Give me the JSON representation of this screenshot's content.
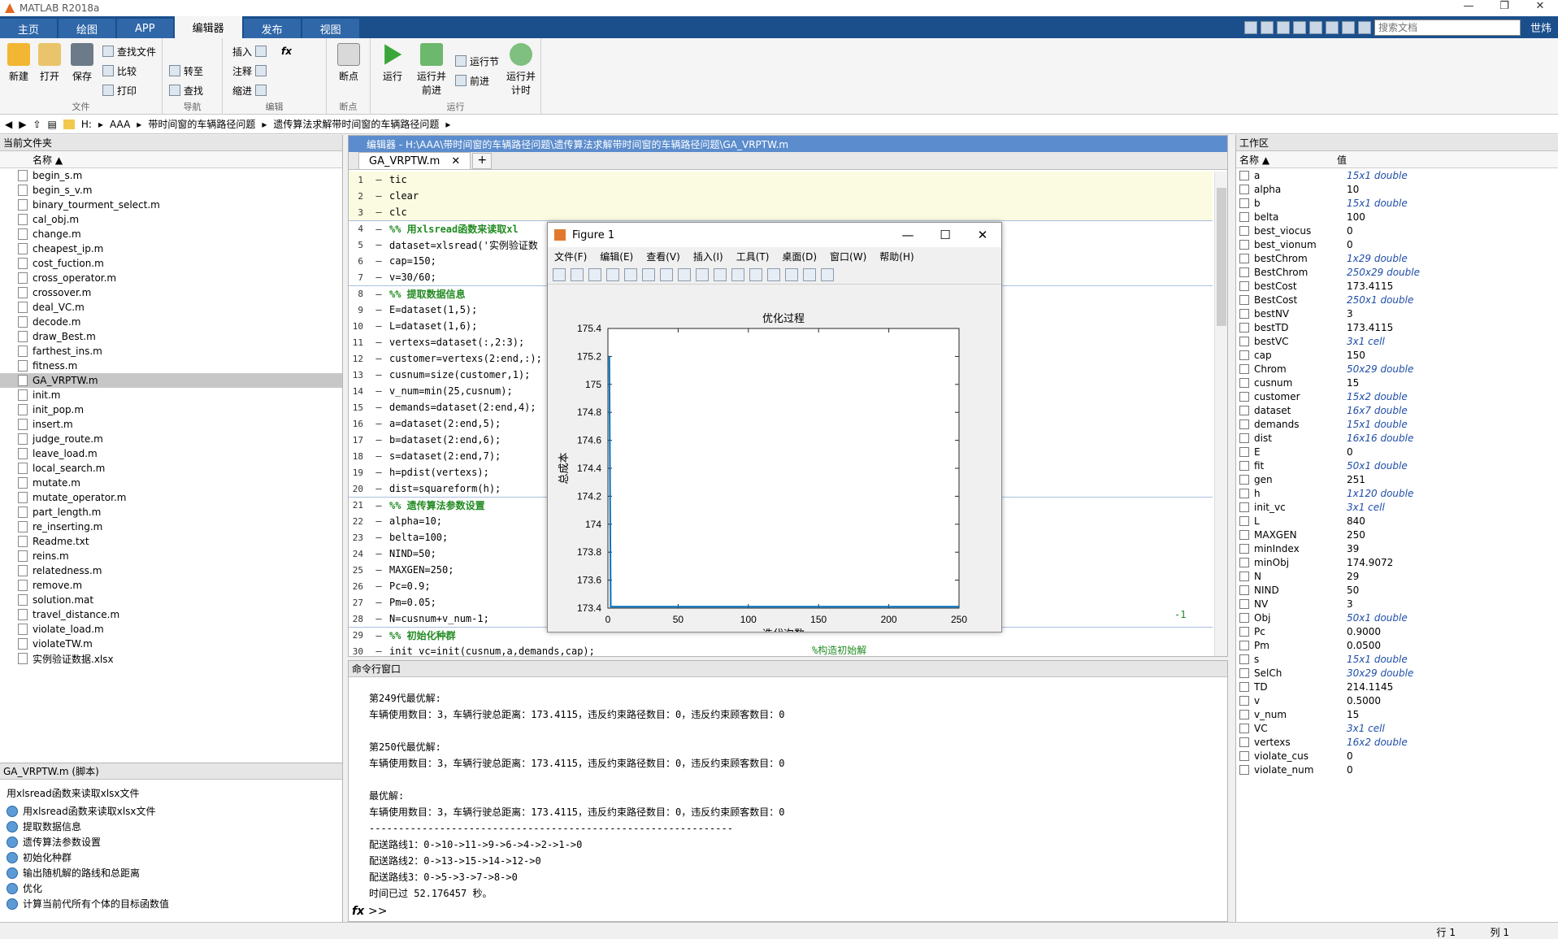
{
  "app": {
    "title": "MATLAB R2018a"
  },
  "ribbon": {
    "tabs": [
      "主页",
      "绘图",
      "APP",
      "编辑器",
      "发布",
      "视图"
    ],
    "search_placeholder": "搜索文档",
    "user": "世炜",
    "file_group": {
      "label": "文件",
      "new": "新建",
      "open": "打开",
      "save": "保存",
      "find_files": "查找文件",
      "compare": "比较",
      "print": "打印"
    },
    "nav_group": {
      "label": "导航",
      "goto": "转至",
      "find": "查找"
    },
    "edit_group": {
      "label": "编辑",
      "insert": "插入",
      "comment": "注释",
      "indent": "缩进",
      "fx": "fx"
    },
    "breakpoint_group": {
      "label": "断点",
      "breakpoints": "断点"
    },
    "run_group": {
      "label": "运行",
      "run": "运行",
      "run_advance": "运行并\n前进",
      "run_section": "运行节",
      "advance": "前进",
      "run_time": "运行并\n计时"
    }
  },
  "addressbar": {
    "path": [
      "H:",
      "AAA",
      "带时间窗的车辆路径问题",
      "遗传算法求解带时间窗的车辆路径问题"
    ]
  },
  "current_folder": {
    "title": "当前文件夹",
    "col_name": "名称 ▲",
    "files": [
      "begin_s.m",
      "begin_s_v.m",
      "binary_tourment_select.m",
      "cal_obj.m",
      "change.m",
      "cheapest_ip.m",
      "cost_fuction.m",
      "cross_operator.m",
      "crossover.m",
      "deal_VC.m",
      "decode.m",
      "draw_Best.m",
      "farthest_ins.m",
      "fitness.m",
      "GA_VRPTW.m",
      "init.m",
      "init_pop.m",
      "insert.m",
      "judge_route.m",
      "leave_load.m",
      "local_search.m",
      "mutate.m",
      "mutate_operator.m",
      "part_length.m",
      "re_inserting.m",
      "Readme.txt",
      "reins.m",
      "relatedness.m",
      "remove.m",
      "solution.mat",
      "travel_distance.m",
      "violate_load.m",
      "violateTW.m",
      "实例验证数据.xlsx"
    ],
    "selected": "GA_VRPTW.m"
  },
  "details": {
    "title": "GA_VRPTW.m (脚本)",
    "desc": "用xlsread函数来读取xlsx文件",
    "sections": [
      "用xlsread函数来读取xlsx文件",
      "提取数据信息",
      "遗传算法参数设置",
      "初始化种群",
      "输出随机解的路线和总距离",
      "优化",
      "计算当前代所有个体的目标函数值"
    ]
  },
  "editor": {
    "header": "编辑器 - H:\\AAA\\带时间窗的车辆路径问题\\遗传算法求解带时间窗的车辆路径问题\\GA_VRPTW.m",
    "tab": "GA_VRPTW.m",
    "lines": [
      {
        "n": "1",
        "t": "tic",
        "c": ""
      },
      {
        "n": "2",
        "t": "clear",
        "c": ""
      },
      {
        "n": "3",
        "t": "clc",
        "c": ""
      },
      {
        "n": "4",
        "t": "%% 用xlsread函数来读取xl",
        "c": "cmt"
      },
      {
        "n": "5",
        "t": "dataset=xlsread('实例验证数",
        "c": ""
      },
      {
        "n": "6",
        "t": "cap=150;",
        "c": ""
      },
      {
        "n": "7",
        "t": "v=30/60;",
        "c": ""
      },
      {
        "n": "8",
        "t": "%% 提取数据信息",
        "c": "cmt"
      },
      {
        "n": "9",
        "t": "E=dataset(1,5);",
        "c": ""
      },
      {
        "n": "10",
        "t": "L=dataset(1,6);",
        "c": ""
      },
      {
        "n": "11",
        "t": "vertexs=dataset(:,2:3);",
        "c": ""
      },
      {
        "n": "12",
        "t": "customer=vertexs(2:end,:);",
        "c": ""
      },
      {
        "n": "13",
        "t": "cusnum=size(customer,1);",
        "c": ""
      },
      {
        "n": "14",
        "t": "v_num=min(25,cusnum);",
        "c": ""
      },
      {
        "n": "15",
        "t": "demands=dataset(2:end,4);",
        "c": ""
      },
      {
        "n": "16",
        "t": "a=dataset(2:end,5);",
        "c": ""
      },
      {
        "n": "17",
        "t": "b=dataset(2:end,6);",
        "c": ""
      },
      {
        "n": "18",
        "t": "s=dataset(2:end,7);",
        "c": ""
      },
      {
        "n": "19",
        "t": "h=pdist(vertexs);",
        "c": ""
      },
      {
        "n": "20",
        "t": "dist=squareform(h);",
        "c": ""
      },
      {
        "n": "21",
        "t": "%% 遗传算法参数设置",
        "c": "cmt"
      },
      {
        "n": "22",
        "t": "alpha=10;",
        "c": ""
      },
      {
        "n": "23",
        "t": "belta=100;",
        "c": ""
      },
      {
        "n": "24",
        "t": "NIND=50;",
        "c": ""
      },
      {
        "n": "25",
        "t": "MAXGEN=250;",
        "c": ""
      },
      {
        "n": "26",
        "t": "Pc=0.9;",
        "c": ""
      },
      {
        "n": "27",
        "t": "Pm=0.05;",
        "c": ""
      },
      {
        "n": "28",
        "t": "N=cusnum+v_num-1;",
        "c": ""
      },
      {
        "n": "29",
        "t": "%% 初始化种群",
        "c": "cmt"
      },
      {
        "n": "30",
        "t": "init_vc=init(cusnum,a,demands,cap);",
        "c": ""
      }
    ],
    "side_fragment": "-1",
    "init_comment": "%构造初始解"
  },
  "command_window": {
    "title": "命令行窗口",
    "lines": [
      "第249代最优解:",
      "车辆使用数目：3，车辆行驶总距离：173.4115，违反约束路径数目：0，违反约束顾客数目：0",
      "",
      "第250代最优解:",
      "车辆使用数目：3，车辆行驶总距离：173.4115，违反约束路径数目：0，违反约束顾客数目：0",
      "",
      "最优解:",
      "车辆使用数目：3，车辆行驶总距离：173.4115，违反约束路径数目：0，违反约束顾客数目：0",
      "--------------------------------------------------------------",
      "配送路线1：0->10->11->9->6->4->2->1->0",
      "配送路线2：0->13->15->14->12->0",
      "配送路线3：0->5->3->7->8->0",
      "时间已过 52.176457 秒。"
    ],
    "prompt": ">>"
  },
  "workspace": {
    "title": "工作区",
    "col_name": "名称 ▲",
    "col_value": "值",
    "vars": [
      {
        "n": "a",
        "v": "15x1 double",
        "i": true
      },
      {
        "n": "alpha",
        "v": "10",
        "i": false
      },
      {
        "n": "b",
        "v": "15x1 double",
        "i": true
      },
      {
        "n": "belta",
        "v": "100",
        "i": false
      },
      {
        "n": "best_viocus",
        "v": "0",
        "i": false
      },
      {
        "n": "best_vionum",
        "v": "0",
        "i": false
      },
      {
        "n": "bestChrom",
        "v": "1x29 double",
        "i": true
      },
      {
        "n": "BestChrom",
        "v": "250x29 double",
        "i": true
      },
      {
        "n": "bestCost",
        "v": "173.4115",
        "i": false
      },
      {
        "n": "BestCost",
        "v": "250x1 double",
        "i": true
      },
      {
        "n": "bestNV",
        "v": "3",
        "i": false
      },
      {
        "n": "bestTD",
        "v": "173.4115",
        "i": false
      },
      {
        "n": "bestVC",
        "v": "3x1 cell",
        "i": true
      },
      {
        "n": "cap",
        "v": "150",
        "i": false
      },
      {
        "n": "Chrom",
        "v": "50x29 double",
        "i": true
      },
      {
        "n": "cusnum",
        "v": "15",
        "i": false
      },
      {
        "n": "customer",
        "v": "15x2 double",
        "i": true
      },
      {
        "n": "dataset",
        "v": "16x7 double",
        "i": true
      },
      {
        "n": "demands",
        "v": "15x1 double",
        "i": true
      },
      {
        "n": "dist",
        "v": "16x16 double",
        "i": true
      },
      {
        "n": "E",
        "v": "0",
        "i": false
      },
      {
        "n": "fit",
        "v": "50x1 double",
        "i": true
      },
      {
        "n": "gen",
        "v": "251",
        "i": false
      },
      {
        "n": "h",
        "v": "1x120 double",
        "i": true
      },
      {
        "n": "init_vc",
        "v": "3x1 cell",
        "i": true
      },
      {
        "n": "L",
        "v": "840",
        "i": false
      },
      {
        "n": "MAXGEN",
        "v": "250",
        "i": false
      },
      {
        "n": "minIndex",
        "v": "39",
        "i": false
      },
      {
        "n": "minObj",
        "v": "174.9072",
        "i": false
      },
      {
        "n": "N",
        "v": "29",
        "i": false
      },
      {
        "n": "NIND",
        "v": "50",
        "i": false
      },
      {
        "n": "NV",
        "v": "3",
        "i": false
      },
      {
        "n": "Obj",
        "v": "50x1 double",
        "i": true
      },
      {
        "n": "Pc",
        "v": "0.9000",
        "i": false
      },
      {
        "n": "Pm",
        "v": "0.0500",
        "i": false
      },
      {
        "n": "s",
        "v": "15x1 double",
        "i": true
      },
      {
        "n": "SelCh",
        "v": "30x29 double",
        "i": true
      },
      {
        "n": "TD",
        "v": "214.1145",
        "i": false
      },
      {
        "n": "v",
        "v": "0.5000",
        "i": false
      },
      {
        "n": "v_num",
        "v": "15",
        "i": false
      },
      {
        "n": "VC",
        "v": "3x1 cell",
        "i": true
      },
      {
        "n": "vertexs",
        "v": "16x2 double",
        "i": true
      },
      {
        "n": "violate_cus",
        "v": "0",
        "i": false
      },
      {
        "n": "violate_num",
        "v": "0",
        "i": false
      }
    ]
  },
  "figure": {
    "title": "Figure 1",
    "menu": [
      "文件(F)",
      "编辑(E)",
      "查看(V)",
      "插入(I)",
      "工具(T)",
      "桌面(D)",
      "窗口(W)",
      "帮助(H)"
    ]
  },
  "chart_data": {
    "type": "line",
    "title": "优化过程",
    "xlabel": "迭代次数",
    "ylabel": "总成本",
    "xlim": [
      0,
      250
    ],
    "ylim": [
      173.4,
      175.4
    ],
    "xticks": [
      "0",
      "50",
      "100",
      "150",
      "200",
      "250"
    ],
    "yticks": [
      "175.4",
      "175.2",
      "175",
      "174.8",
      "174.6",
      "174.4",
      "174.2",
      "174",
      "173.8",
      "173.6",
      "173.4"
    ],
    "series": [
      {
        "x": [
          1,
          2,
          250
        ],
        "y": [
          175.2,
          173.41,
          173.41
        ]
      }
    ],
    "color": "#0072bd"
  },
  "statusbar": {
    "row_label": "行",
    "row": "1",
    "col_label": "列",
    "col": "1"
  }
}
